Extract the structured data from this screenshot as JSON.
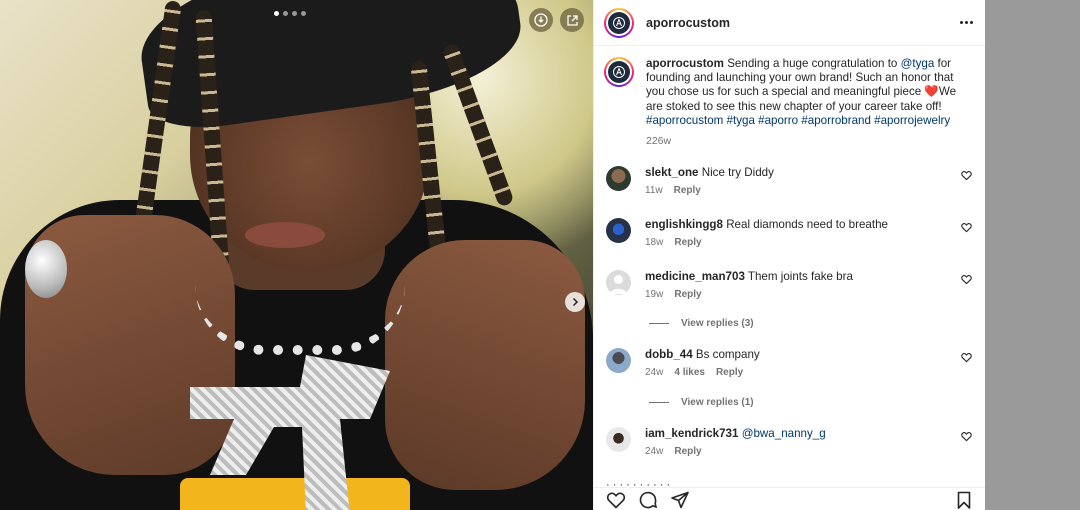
{
  "post": {
    "account": {
      "username": "aporrocustom",
      "avatar_icon": "aporro-logo-icon"
    },
    "caption": {
      "username": "aporrocustom",
      "text_before_mention": "Sending a huge congratulation to ",
      "mention": "@tyga",
      "text_after_mention": " for founding and launching your own brand! Such an honor that you chose us for such a special and meaningful piece ",
      "emoji": "❤️",
      "text_after_emoji": "We are stoked to see this new chapter of your career take off!",
      "hashtags": "#aporrocustom #tyga #aporro #aporrobrand #aporrojewelry",
      "time": "226w"
    },
    "carousel": {
      "current_index": 1,
      "total": 4
    },
    "colors": {
      "link": "#00376b",
      "muted": "#737373",
      "text": "#262626",
      "heart_emoji": "#e0245e"
    }
  },
  "comments": [
    {
      "username": "slekt_one",
      "text": "Nice try Diddy",
      "time": "11w",
      "likes": "",
      "reply": "Reply",
      "view_replies": ""
    },
    {
      "username": "englishkingg8",
      "text": "Real diamonds need to breathe",
      "time": "18w",
      "likes": "",
      "reply": "Reply",
      "view_replies": ""
    },
    {
      "username": "medicine_man703",
      "text": "Them joints fake bra",
      "time": "19w",
      "likes": "",
      "reply": "Reply",
      "view_replies": "View replies (3)"
    },
    {
      "username": "dobb_44",
      "text": "Bs company",
      "time": "24w",
      "likes": "4 likes",
      "reply": "Reply",
      "view_replies": "View replies (1)"
    },
    {
      "username": "iam_kendrick731",
      "text": "@bwa_nanny_g",
      "time": "24w",
      "likes": "",
      "reply": "Reply",
      "view_replies": ""
    }
  ],
  "partial_comment_text": "· · · · · · · · · ·",
  "actions": {
    "like_icon": "heart-outline-icon",
    "comment_icon": "comment-bubble-icon",
    "share_icon": "share-paper-plane-icon",
    "save_icon": "bookmark-icon"
  }
}
